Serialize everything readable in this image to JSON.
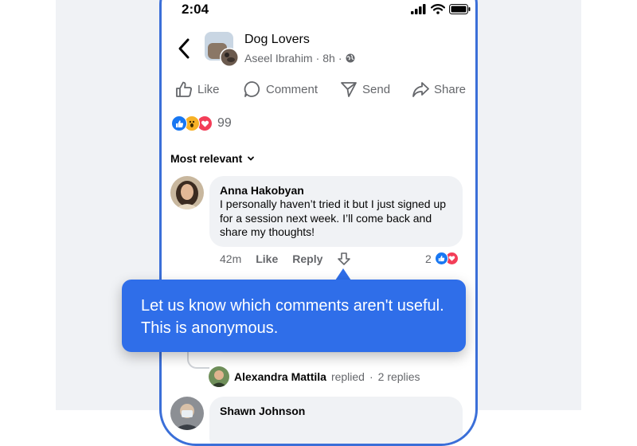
{
  "status_bar": {
    "time": "2:04"
  },
  "post_header": {
    "group_name": "Dog Lovers",
    "author": "Aseel Ibrahim",
    "age": "8h"
  },
  "actions": [
    {
      "label": "Like",
      "icon": "thumbs-up-icon"
    },
    {
      "label": "Comment",
      "icon": "comment-icon"
    },
    {
      "label": "Send",
      "icon": "send-icon"
    },
    {
      "label": "Share",
      "icon": "share-icon"
    }
  ],
  "reactions": {
    "types": [
      "like",
      "wow",
      "love"
    ],
    "count": "99"
  },
  "sort": {
    "label": "Most relevant"
  },
  "comment": {
    "author": "Anna Hakobyan",
    "text": "I personally haven’t tried it but I just signed up for a session next week. I’ll come back and share my thoughts!",
    "time": "42m",
    "like_label": "Like",
    "reply_label": "Reply",
    "reaction_count": "2"
  },
  "tooltip": {
    "text": "Let us know which comments aren't useful. This is anonymous."
  },
  "replies": {
    "author": "Alexandra Mattila",
    "action": "replied",
    "separator": "·",
    "count": "2 replies"
  },
  "next_comment": {
    "author": "Shawn Johnson"
  },
  "colors": {
    "accent": "#2f6ee9",
    "like_blue": "#1877f2",
    "love_red": "#f33e58",
    "frame_blue": "#3b6fd8"
  }
}
